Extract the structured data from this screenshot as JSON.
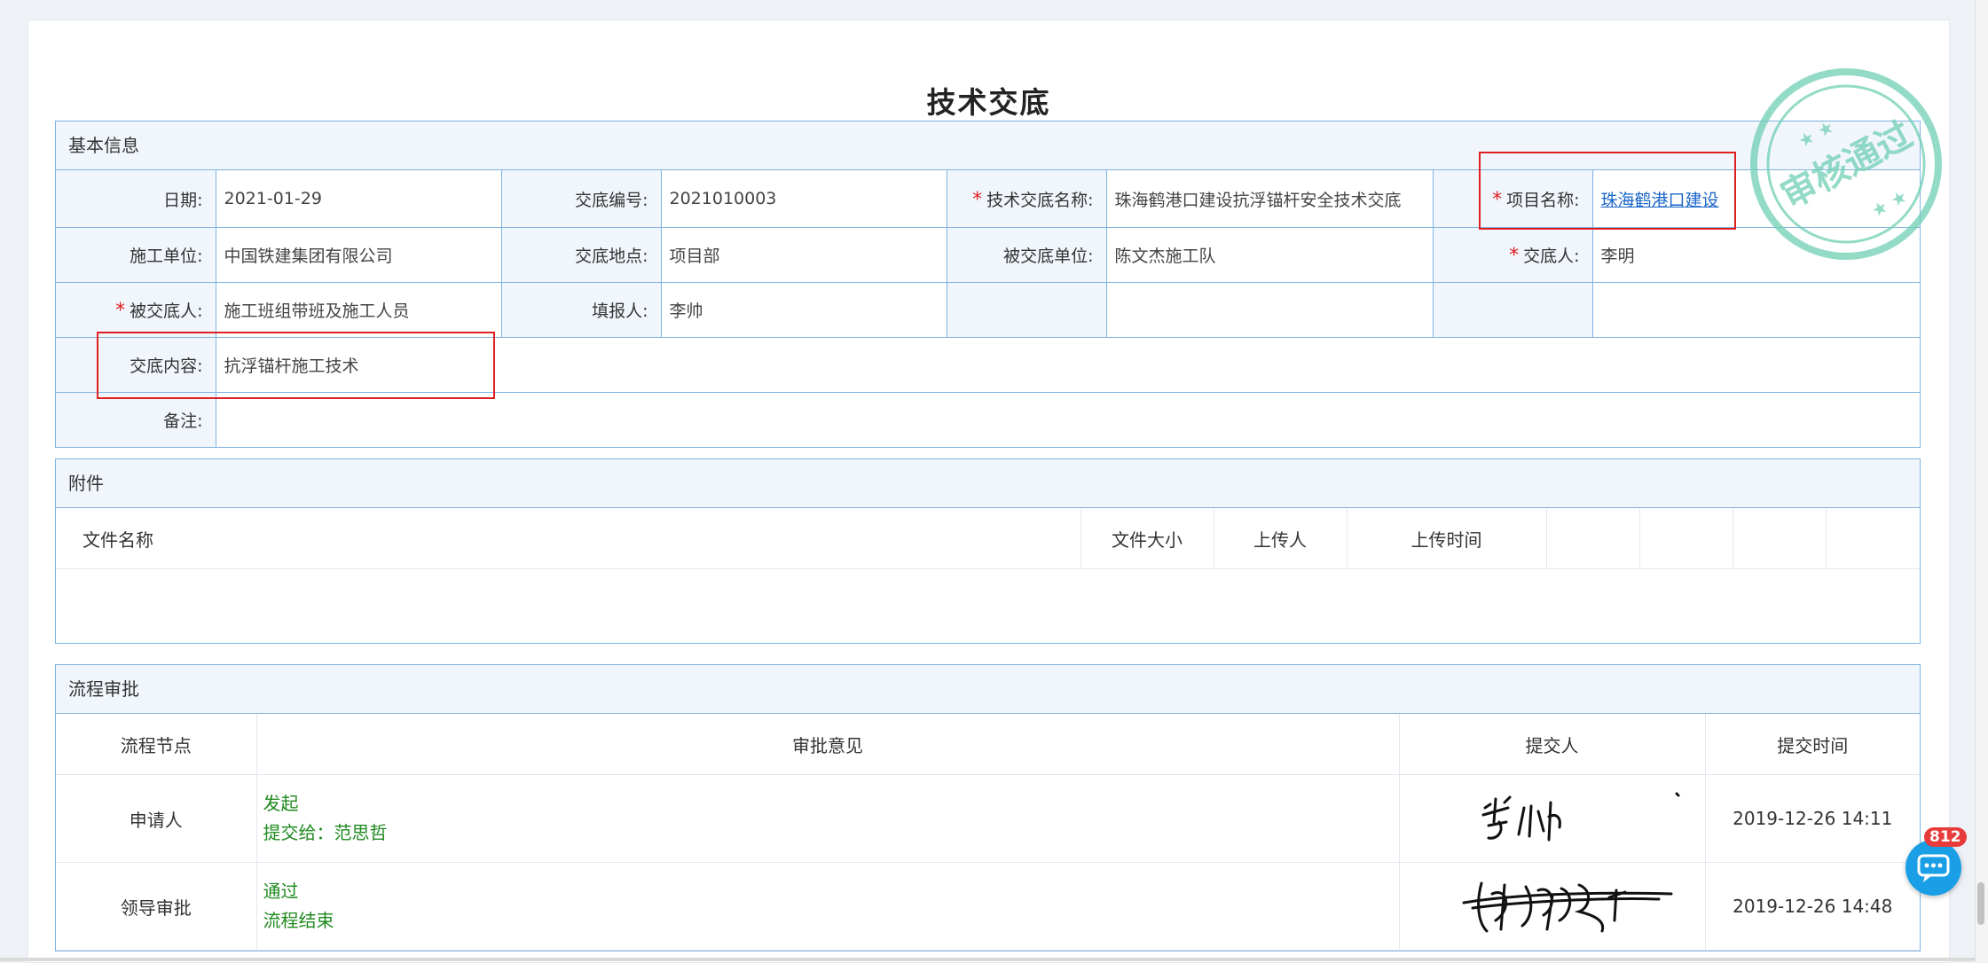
{
  "page": {
    "title": "技术交底"
  },
  "basic": {
    "header": "基本信息",
    "date_label": "日期:",
    "date_value": "2021-01-29",
    "code_label": "交底编号:",
    "code_value": "2021010003",
    "name_label": "技术交底名称:",
    "name_value": "珠海鹤港口建设抗浮锚杆安全技术交底",
    "project_label": "项目名称:",
    "project_value": "珠海鹤港口建设",
    "unit_label": "施工单位:",
    "unit_value": "中国铁建集团有限公司",
    "place_label": "交底地点:",
    "place_value": "项目部",
    "recv_unit_label": "被交底单位:",
    "recv_unit_value": "陈文杰施工队",
    "giver_label": "交底人:",
    "giver_value": "李明",
    "receiver_label": "被交底人:",
    "receiver_value": "施工班组带班及施工人员",
    "reporter_label": "填报人:",
    "reporter_value": "李帅",
    "content_label": "交底内容:",
    "content_value": "抗浮锚杆施工技术",
    "remark_label": "备注:",
    "remark_value": ""
  },
  "attachments": {
    "header": "附件",
    "columns": [
      "文件名称",
      "文件大小",
      "上传人",
      "上传时间"
    ]
  },
  "flow": {
    "header": "流程审批",
    "columns": [
      "流程节点",
      "审批意见",
      "提交人",
      "提交时间"
    ],
    "rows": [
      {
        "node": "申请人",
        "line1": "发起",
        "line2": "提交给：范思哲",
        "time": "2019-12-26 14:11"
      },
      {
        "node": "领导审批",
        "line1": "通过",
        "line2": "流程结束",
        "time": "2019-12-26 14:48"
      }
    ]
  },
  "stamp": {
    "text": "审核通过",
    "color": "#6fcfb4"
  },
  "chat": {
    "badge": "812",
    "icon": "chat-bubble-icon",
    "color": "#1a9fe6"
  },
  "colors": {
    "border": "#7fb3e0",
    "label_bg": "#f1f6fc",
    "required": "#e02020",
    "approve_text": "#1f8a1f",
    "link": "#1a66c8"
  }
}
